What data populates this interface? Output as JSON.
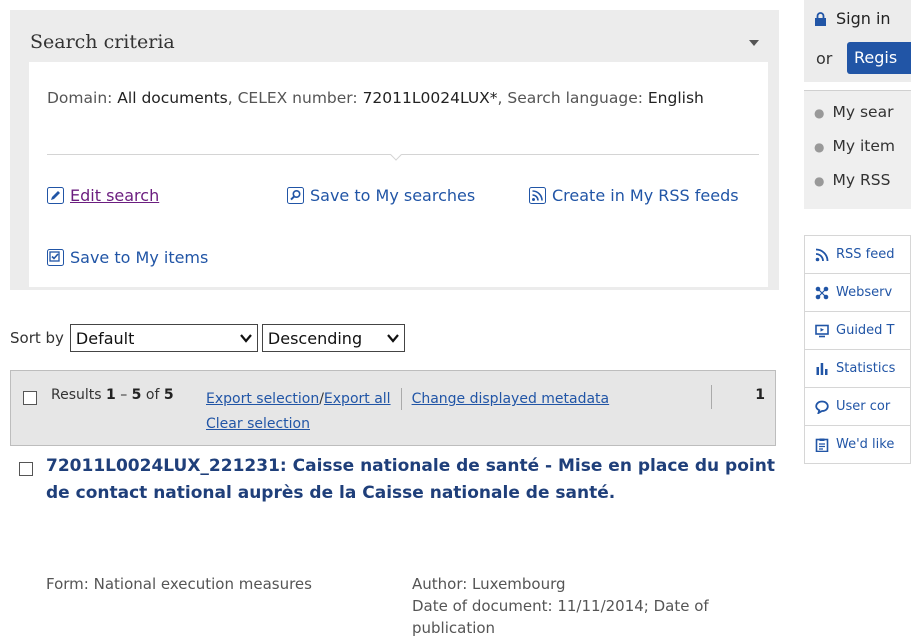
{
  "criteria": {
    "title": "Search criteria",
    "domain_label": "Domain: ",
    "domain_value": "All documents",
    "celex_label": ", CELEX number: ",
    "celex_value": "72011L0024LUX*",
    "lang_label": ", Search language: ",
    "lang_value": "English",
    "actions": {
      "edit": "Edit search",
      "save_searches": "Save to My searches",
      "rss": "Create in My RSS feeds",
      "save_items": "Save to My items"
    }
  },
  "sort": {
    "label": "Sort by",
    "field": "Default",
    "order": "Descending"
  },
  "results": {
    "prefix": "Results ",
    "from": "1",
    "dash": " – ",
    "to": "5",
    "of": " of ",
    "total": "5",
    "export_selection": "Export selection",
    "slash": "/",
    "export_all": "Export all",
    "change_metadata": "Change displayed metadata",
    "clear_selection": "Clear selection",
    "page": "1"
  },
  "item": {
    "id": "72011L0024LUX_221231",
    "title_rest": ": Caisse nationale de santé - Mise en place du point de contact national auprès de la Caisse nationale de santé.",
    "form": "Form: National execution measures",
    "author": "Author: Luxembourg",
    "date": "Date of document: 11/11/2014; Date of publication"
  },
  "sidebar": {
    "sign_in": "Sign in",
    "or": "or",
    "register": "Regis",
    "my_items": [
      "My sear",
      "My item",
      "My RSS"
    ],
    "tools": [
      "RSS feed",
      "Webserv",
      "Guided T",
      "Statistics",
      "User cor",
      "We'd like"
    ]
  },
  "colors": {
    "link": "#2155a6",
    "title": "#1f3f7a",
    "visited": "#6b1d7f",
    "panel": "#ececec"
  }
}
